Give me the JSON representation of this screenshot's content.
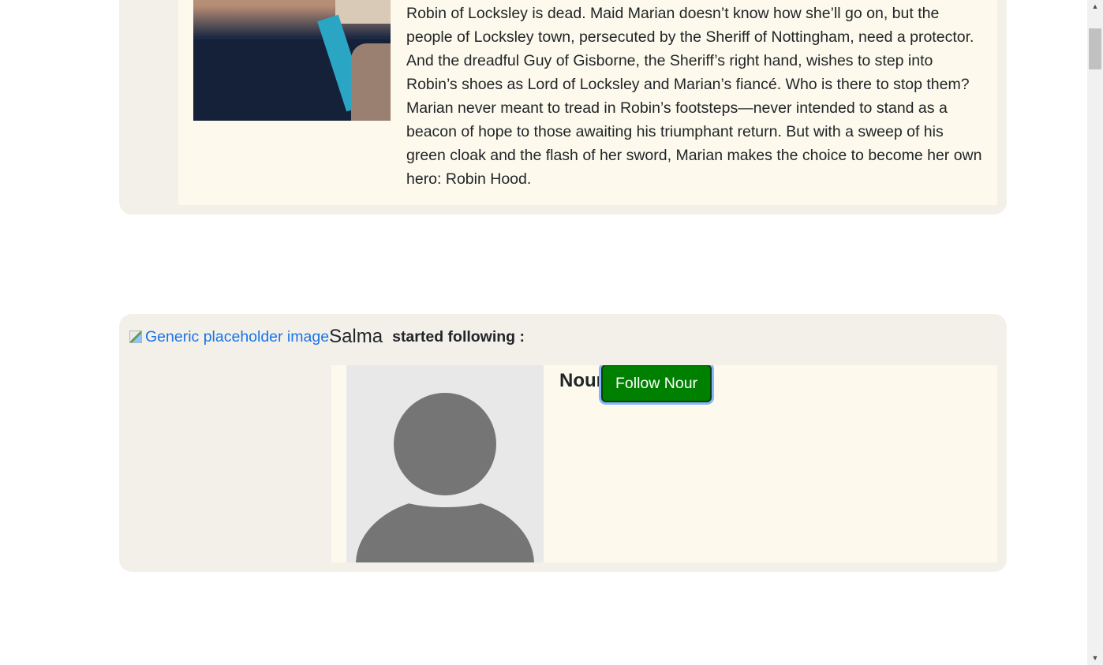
{
  "post": {
    "description": "Robin of Locksley is dead. Maid Marian doesn’t know how she’ll go on, but the people of Locksley town, persecuted by the Sheriff of Nottingham, need a protector. And the dreadful Guy of Gisborne, the Sheriff’s right hand, wishes to step into Robin’s shoes as Lord of Locksley and Marian’s fiancé. Who is there to stop them? Marian never meant to tread in Robin’s footsteps—never intended to stand as a beacon of hope to those awaiting his triumphant return. But with a sweep of his green cloak and the flash of her sword, Marian makes the choice to become her own hero: Robin Hood."
  },
  "activity": {
    "actor_image_alt": "Generic placeholder image",
    "actor_name": "Salma",
    "action_text": "started following :",
    "target_name": "Nour",
    "follow_button_label": "Follow Nour"
  },
  "colors": {
    "card_bg": "#f3f0e9",
    "inner_bg": "#fdf9ec",
    "follow_button": "#008000",
    "link": "#1a73e8"
  },
  "icons": {
    "avatar": "default-user-avatar-icon",
    "broken_image": "broken-image-icon",
    "scroll_up": "scroll-up-arrow-icon",
    "scroll_down": "scroll-down-arrow-icon"
  }
}
